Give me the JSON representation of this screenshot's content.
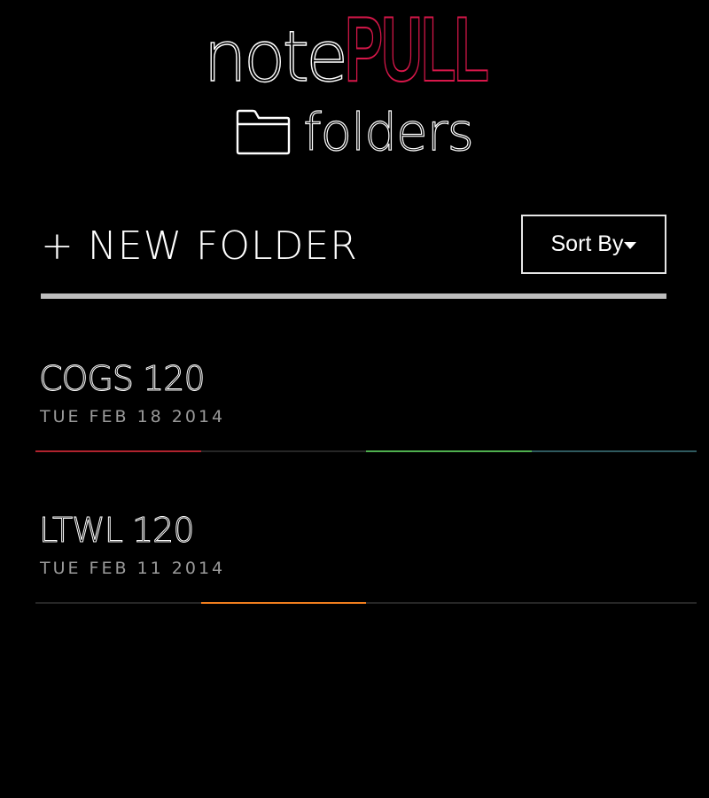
{
  "header": {
    "logo_note": "note",
    "logo_pull": "PULL",
    "subtitle": "folders"
  },
  "toolbar": {
    "new_folder_label": "+ NEW FOLDER",
    "sort_label": "Sort By"
  },
  "folders": [
    {
      "name": "COGS 120",
      "date": "TUE FEB 18 2014",
      "tag_colors": [
        "#b0232e",
        "#262626",
        "#4fb04f",
        "#2f5a5f"
      ]
    },
    {
      "name": "LTWL 120",
      "date": "TUE FEB 11 2014",
      "tag_colors": [
        "#262626",
        "#f07e1e",
        "#262626",
        "#262626"
      ]
    }
  ],
  "colors": {
    "background": "#000000",
    "brand_accent": "#d8174a",
    "divider": "#bdbdbd",
    "date_text": "#9a9a9a"
  }
}
